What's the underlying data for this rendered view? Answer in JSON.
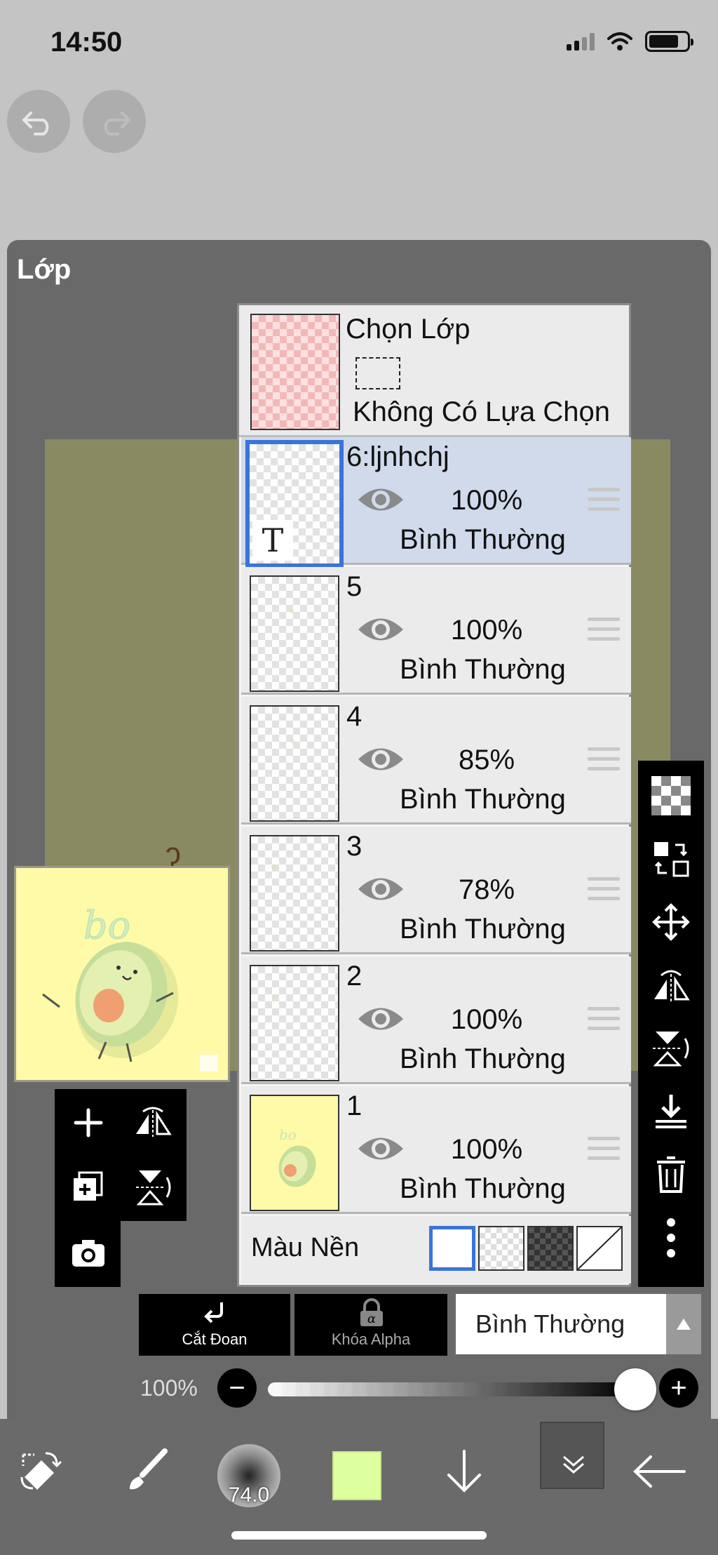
{
  "status_bar": {
    "time": "14:50"
  },
  "panel": {
    "title": "Lớp"
  },
  "selection": {
    "title": "Chọn Lớp",
    "status": "Không Có Lựa Chọn"
  },
  "layers": [
    {
      "name": "6:ljnhchj",
      "opacity": "100%",
      "blend": "Bình Thường",
      "selected": true,
      "type": "text"
    },
    {
      "name": "5",
      "opacity": "100%",
      "blend": "Bình Thường",
      "selected": false
    },
    {
      "name": "4",
      "opacity": "85%",
      "blend": "Bình Thường",
      "selected": false
    },
    {
      "name": "3",
      "opacity": "78%",
      "blend": "Bình Thường",
      "selected": false
    },
    {
      "name": "2",
      "opacity": "100%",
      "blend": "Bình Thường",
      "selected": false
    },
    {
      "name": "1",
      "opacity": "100%",
      "blend": "Bình Thường",
      "selected": false
    }
  ],
  "background": {
    "label": "Màu Nền"
  },
  "actions": {
    "clipping_label": "Cắt Đoan",
    "alpha_lock_label": "Khóa Alpha"
  },
  "blend_mode": {
    "value": "Bình Thường"
  },
  "opacity_bar": {
    "label": "100%",
    "value": 1.0
  },
  "bottom_bar": {
    "brush_size": "74.0",
    "color": "#ddff9e"
  },
  "icons": [
    "undo-icon",
    "redo-icon",
    "eye-icon",
    "drag-handle-icon",
    "add-icon",
    "flip-horizontal-icon",
    "duplicate-icon",
    "flip-vertical-icon",
    "camera-icon",
    "checker-icon",
    "swap-icon",
    "move-icon",
    "merge-down-icon",
    "trash-icon",
    "more-icon",
    "clipping-icon",
    "lock-icon",
    "transform-icon",
    "brush-icon",
    "arrow-down-icon",
    "chevron-down-icon",
    "back-arrow-icon"
  ],
  "colors": {
    "selected_layer": "#d0daeb",
    "accent": "#3a74d8"
  }
}
